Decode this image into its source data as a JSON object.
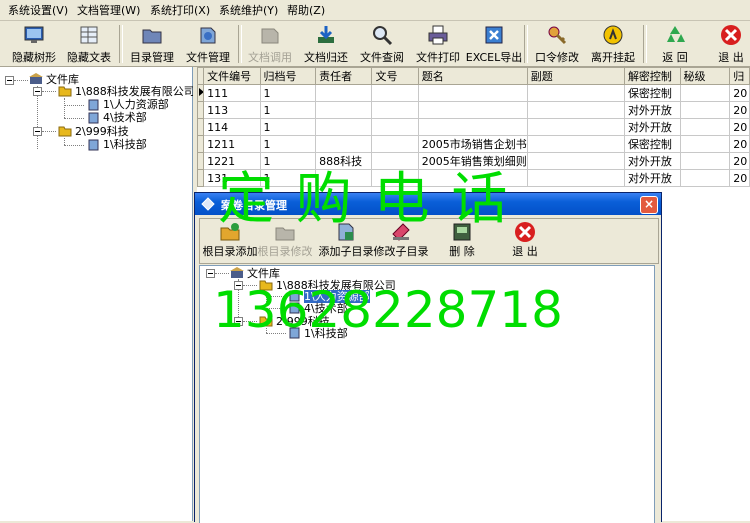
{
  "menu": {
    "items": [
      {
        "label": "系统设置(V)"
      },
      {
        "label": "文档管理(W)"
      },
      {
        "label": "系统打印(X)"
      },
      {
        "label": "系统维护(Y)"
      },
      {
        "label": "帮助(Z)"
      }
    ]
  },
  "toolbar": {
    "buttons": [
      {
        "label": "隐藏树形",
        "icon": "monitor-icon"
      },
      {
        "label": "隐藏文表",
        "icon": "table-icon"
      },
      {
        "label": "目录管理",
        "icon": "folder-icon"
      },
      {
        "label": "文件管理",
        "icon": "document-icon"
      },
      {
        "label": "文档调用",
        "icon": "doc-call-icon",
        "disabled": true
      },
      {
        "label": "文档归还",
        "icon": "download-icon"
      },
      {
        "label": "文件查阅",
        "icon": "magnifier-icon"
      },
      {
        "label": "文件打印",
        "icon": "printer-icon"
      },
      {
        "label": "EXCEL导出",
        "icon": "excel-icon"
      },
      {
        "label": "口令修改",
        "icon": "key-icon"
      },
      {
        "label": "离开挂起",
        "icon": "suspend-icon"
      },
      {
        "label": "返  回",
        "icon": "recycle-icon"
      },
      {
        "label": "退  出",
        "icon": "exit-icon"
      }
    ]
  },
  "tree": {
    "root": "文件库",
    "company1": "1\\888科技发展有限公司",
    "dept1": "1\\人力资源部",
    "dept2": "4\\技术部",
    "company2": "2\\999科技",
    "dept3": "1\\科技部"
  },
  "grid": {
    "columns": [
      "文件编号",
      "归档号",
      "责任者",
      "文号",
      "题名",
      "副题",
      "解密控制",
      "秘级",
      "归"
    ],
    "rows": [
      [
        "111",
        "1",
        "",
        "",
        "",
        "",
        "保密控制",
        "",
        "20"
      ],
      [
        "113",
        "1",
        "",
        "",
        "",
        "",
        "对外开放",
        "",
        "20"
      ],
      [
        "114",
        "1",
        "",
        "",
        "",
        "",
        "对外开放",
        "",
        "20"
      ],
      [
        "1211",
        "1",
        "",
        "",
        "2005市场销售企划书",
        "",
        "保密控制",
        "",
        "20"
      ],
      [
        "1221",
        "1",
        "888科技",
        "",
        "2005年销售策划细则",
        "",
        "对外开放",
        "",
        "20"
      ],
      [
        "131",
        "1",
        "",
        "",
        "",
        "",
        "对外开放",
        "",
        "20"
      ]
    ]
  },
  "dialog": {
    "title": "案卷目录管理",
    "close": "×",
    "buttons": [
      {
        "label": "根目录添加",
        "icon": "add-root-icon"
      },
      {
        "label": "根目录修改",
        "icon": "edit-root-icon",
        "disabled": true
      },
      {
        "label": "添加子目录",
        "icon": "add-sub-icon"
      },
      {
        "label": "修改子目录",
        "icon": "edit-sub-icon"
      },
      {
        "label": "删  除",
        "icon": "delete-icon"
      },
      {
        "label": "退  出",
        "icon": "exit-icon"
      }
    ],
    "tree": {
      "root": "文件库",
      "company1": "1\\888科技发展有限公司",
      "dept1": "1\\人力资源部",
      "dept2": "4\\技术部",
      "company2": "2\\999科技",
      "dept3": "1\\科技部"
    }
  },
  "watermark": {
    "line1": "定  购  电  话",
    "line2": "13628228718"
  }
}
